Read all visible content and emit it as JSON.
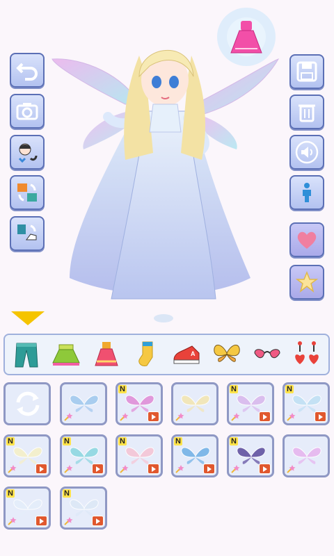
{
  "left_toolbar": {
    "buttons": [
      {
        "name": "undo",
        "icon": "undo-icon"
      },
      {
        "name": "screenshot",
        "icon": "camera-icon"
      },
      {
        "name": "random-face",
        "icon": "face-swap-icon"
      },
      {
        "name": "random-outfit",
        "icon": "outfit-swap-icon"
      },
      {
        "name": "random-shoes",
        "icon": "shoes-swap-icon"
      }
    ]
  },
  "right_toolbar": {
    "buttons": [
      {
        "name": "save",
        "icon": "floppy-disk-icon"
      },
      {
        "name": "delete",
        "icon": "trash-icon"
      },
      {
        "name": "sound",
        "icon": "speaker-icon"
      },
      {
        "name": "body",
        "icon": "person-icon"
      },
      {
        "name": "favorite",
        "icon": "heart-icon"
      },
      {
        "name": "rate",
        "icon": "star-icon"
      }
    ]
  },
  "current_category_badge": {
    "icon": "dress-icon",
    "color": "#f24fa8"
  },
  "categories": [
    {
      "name": "pants",
      "icon": "pants-icon"
    },
    {
      "name": "skirt",
      "icon": "skirt-icon"
    },
    {
      "name": "dress",
      "icon": "dress-icon"
    },
    {
      "name": "socks",
      "icon": "sock-icon"
    },
    {
      "name": "sneakers",
      "icon": "sneaker-icon"
    },
    {
      "name": "wings",
      "icon": "butterfly-icon",
      "selected": true
    },
    {
      "name": "glasses",
      "icon": "heart-glasses-icon"
    },
    {
      "name": "earrings",
      "icon": "heart-earrings-icon"
    }
  ],
  "items": [
    {
      "icon": "reset-icon",
      "new": false,
      "locked": false
    },
    {
      "icon": "wings-icon",
      "new": false,
      "locked": false,
      "color": "#9fc8ee"
    },
    {
      "icon": "wings-icon",
      "new": true,
      "new_label": "N",
      "locked": true,
      "color": "#e08ad6"
    },
    {
      "icon": "wings-icon",
      "new": false,
      "locked": false,
      "color": "#f4e6b0"
    },
    {
      "icon": "wings-icon",
      "new": true,
      "new_label": "N",
      "locked": true,
      "color": "#d9b6ec"
    },
    {
      "icon": "wings-icon",
      "new": true,
      "new_label": "N",
      "locked": true,
      "color": "#bfe0f4"
    },
    {
      "icon": "wings-icon",
      "new": true,
      "new_label": "N",
      "locked": true,
      "color": "#f6f0c6"
    },
    {
      "icon": "wings-icon",
      "new": true,
      "new_label": "N",
      "locked": true,
      "color": "#8ad6df"
    },
    {
      "icon": "wings-icon",
      "new": true,
      "new_label": "N",
      "locked": true,
      "color": "#f6c4d4"
    },
    {
      "icon": "wings-icon",
      "new": true,
      "new_label": "N",
      "locked": true,
      "color": "#6fb0e6"
    },
    {
      "icon": "wings-icon",
      "new": true,
      "new_label": "N",
      "locked": true,
      "color": "#5b4a9c"
    },
    {
      "icon": "wings-icon",
      "new": false,
      "locked": false,
      "color": "#e6b3ee"
    },
    {
      "icon": "wings-icon",
      "new": true,
      "new_label": "N",
      "locked": true,
      "color": "#e4eefa"
    },
    {
      "icon": "wings-icon",
      "new": true,
      "new_label": "N",
      "locked": true,
      "color": "#dce8f6"
    }
  ]
}
